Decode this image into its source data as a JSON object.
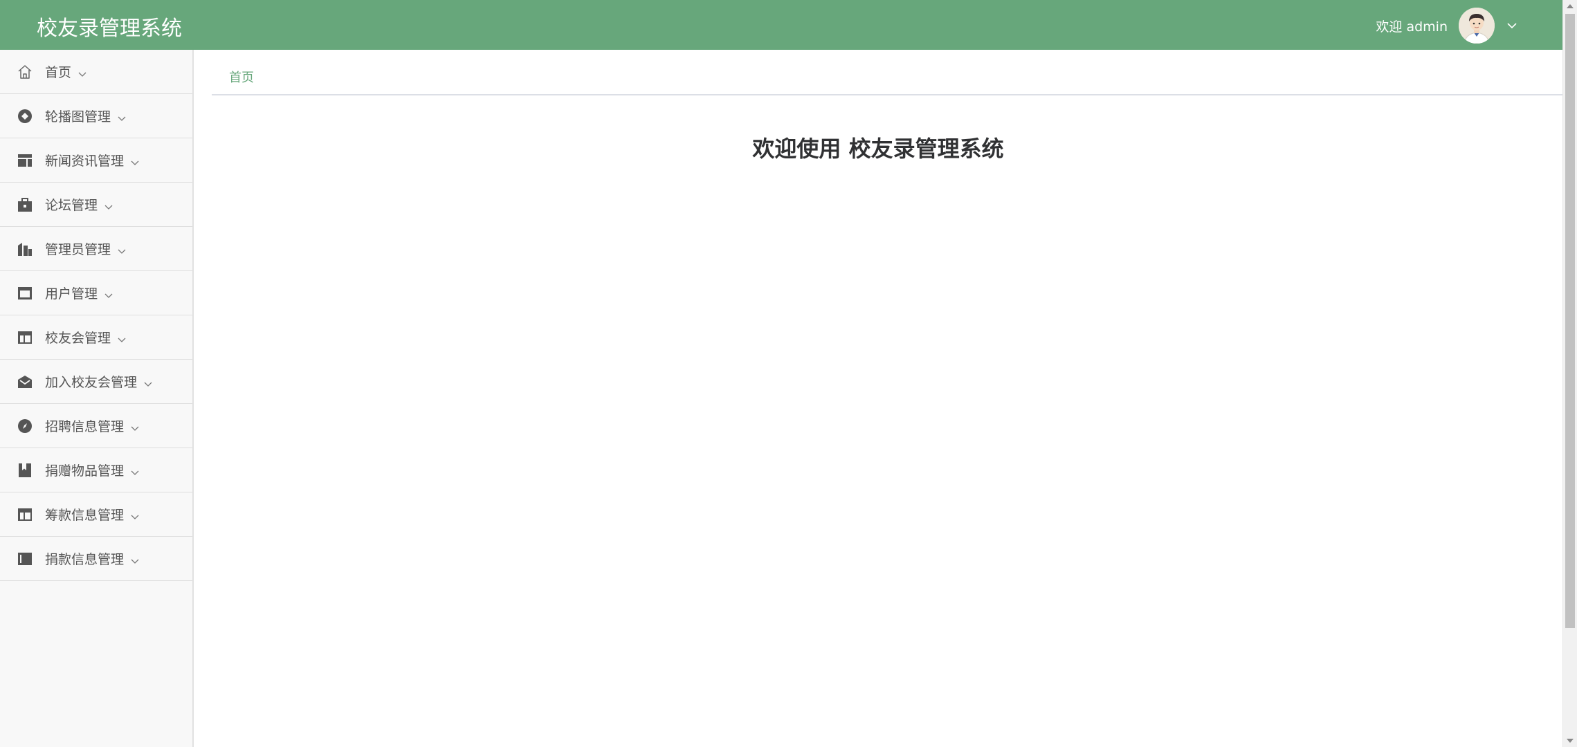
{
  "header": {
    "title": "校友录管理系统",
    "welcome_text": "欢迎 admin",
    "avatar_icon": "avatar-icon",
    "dropdown_icon": "chevron-down-icon",
    "background_color": "#67a77b"
  },
  "sidebar": {
    "items": [
      {
        "label": "首页",
        "icon": "home-icon"
      },
      {
        "label": "轮播图管理",
        "icon": "circle-diamond-icon"
      },
      {
        "label": "新闻资讯管理",
        "icon": "layout-icon"
      },
      {
        "label": "论坛管理",
        "icon": "briefcase-icon"
      },
      {
        "label": "管理员管理",
        "icon": "building-icon"
      },
      {
        "label": "用户管理",
        "icon": "window-icon"
      },
      {
        "label": "校友会管理",
        "icon": "table-layout-icon"
      },
      {
        "label": "加入校友会管理",
        "icon": "mail-open-icon"
      },
      {
        "label": "招聘信息管理",
        "icon": "compass-icon"
      },
      {
        "label": "捐赠物品管理",
        "icon": "bookmark-icon"
      },
      {
        "label": "筹款信息管理",
        "icon": "table-layout-icon"
      },
      {
        "label": "捐款信息管理",
        "icon": "sidebar-panel-icon"
      }
    ]
  },
  "main": {
    "breadcrumb": "首页",
    "heading": "欢迎使用 校友录管理系统"
  },
  "colors": {
    "accent": "#67a77b",
    "sidebar_bg": "#f8f8f8",
    "icon_color": "#555555"
  }
}
